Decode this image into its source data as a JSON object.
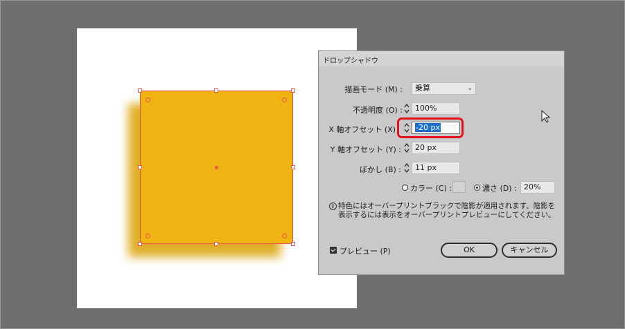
{
  "dialog": {
    "title": "ドロップシャドウ",
    "blend_mode": {
      "label": "描画モード (M) :",
      "value": "乗算",
      "chevron": "⌄"
    },
    "opacity": {
      "label": "不透明度 (O) :",
      "value": "100%"
    },
    "x_offset": {
      "label": "X 軸オフセット (X)",
      "value": "-20 px"
    },
    "y_offset": {
      "label": "Y 軸オフセット (Y) :",
      "value": "20 px"
    },
    "blur": {
      "label": "ぼかし (B) :",
      "value": "11 px"
    },
    "color": {
      "label": "カラー (C) :",
      "selected": false
    },
    "darkness": {
      "label": "濃さ (D) :",
      "value": "20%",
      "selected": true
    },
    "info_icon": "info-icon",
    "note": "特色にはオーバープリントブラックで陰影が適用されます。陰影を表示するには表示をオーバープリントプレビューにしてください。",
    "preview": {
      "label": "プレビュー (P)",
      "checked": true
    },
    "ok_label": "OK",
    "cancel_label": "キャンセル"
  },
  "colors": {
    "object_fill": "#f0b412",
    "shadow": "#d9a000",
    "selection": "#e8574c",
    "highlight": "#e3101a",
    "text_selection": "#1f6fd1"
  }
}
